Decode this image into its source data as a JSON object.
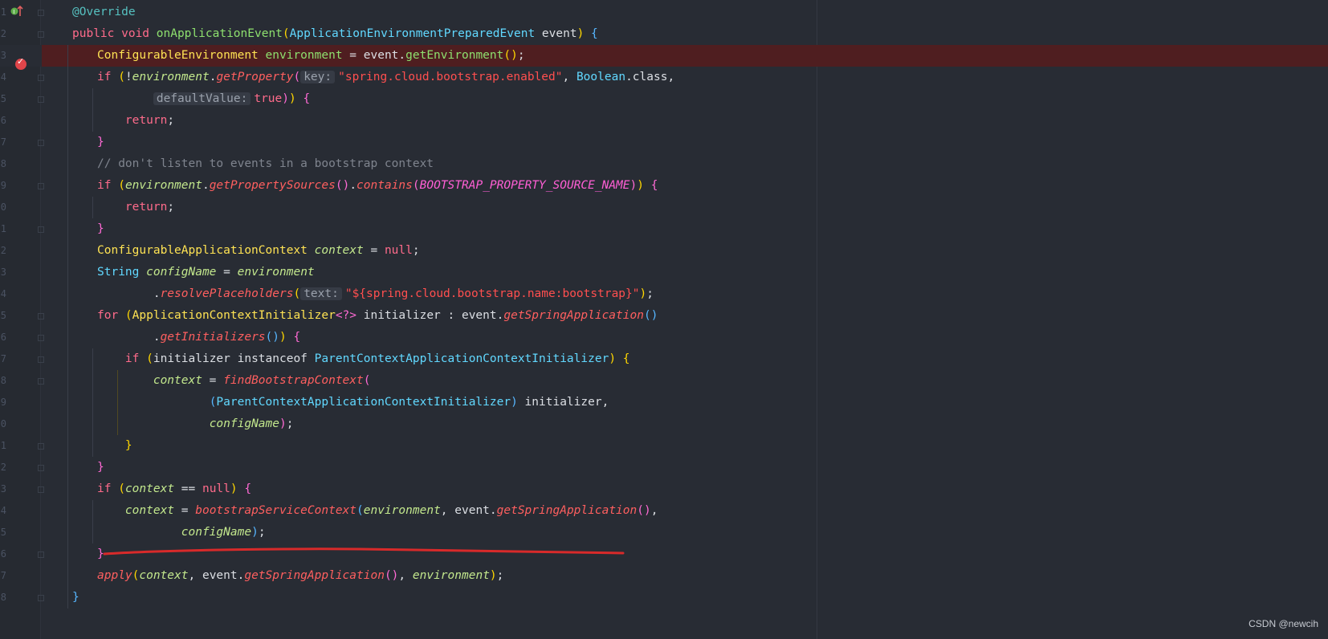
{
  "editor": {
    "watermark": "CSDN @newcih",
    "line_numbers": [
      "1",
      "2",
      "3",
      "4",
      "5",
      "6",
      "7",
      "8",
      "9",
      "0",
      "1",
      "2",
      "3",
      "4",
      "5",
      "6",
      "7",
      "8",
      "9",
      "0",
      "1",
      "2",
      "3",
      "4",
      "5",
      "6",
      "7",
      "8"
    ],
    "lines": [
      [
        [
          "ann",
          "@Override"
        ]
      ],
      [
        [
          "kw",
          "public void "
        ],
        [
          "fn",
          "onApplicationEvent"
        ],
        [
          "p1",
          "("
        ],
        [
          "type2",
          "ApplicationEnvironmentPreparedEvent "
        ],
        [
          "plain",
          "event"
        ],
        [
          "p1",
          ")"
        ],
        [
          "plain",
          " "
        ],
        [
          "p3",
          "{"
        ]
      ],
      [
        [
          "type",
          "ConfigurableEnvironment "
        ],
        [
          "fn",
          "environment"
        ],
        [
          "plain",
          " = "
        ],
        [
          "plain",
          "event."
        ],
        [
          "fn",
          "getEnvironment"
        ],
        [
          "p1",
          "()"
        ],
        [
          "plain",
          ";"
        ]
      ],
      [
        [
          "kw",
          "if "
        ],
        [
          "p1",
          "("
        ],
        [
          "plain",
          "!"
        ],
        [
          "v",
          "environment"
        ],
        [
          "plain",
          "."
        ],
        [
          "m",
          "getProperty"
        ],
        [
          "p2",
          "("
        ],
        [
          "hint",
          "key:"
        ],
        [
          "str",
          "\"spring.cloud.bootstrap.enabled\""
        ],
        [
          "plain",
          ", "
        ],
        [
          "type2",
          "Boolean"
        ],
        [
          "plain",
          "."
        ],
        [
          "plain",
          "class,"
        ]
      ],
      [
        [
          "plain",
          "        "
        ],
        [
          "hint",
          "defaultValue:"
        ],
        [
          "kw",
          "true"
        ],
        [
          "p2",
          ")"
        ],
        [
          "p1",
          ")"
        ],
        [
          "plain",
          " "
        ],
        [
          "p2",
          "{"
        ]
      ],
      [
        [
          "plain",
          "    "
        ],
        [
          "kw",
          "return"
        ],
        [
          "plain",
          ";"
        ]
      ],
      [
        [
          "p2",
          "}"
        ]
      ],
      [
        [
          "cmt",
          "// don't listen to events in a bootstrap context"
        ]
      ],
      [
        [
          "kw",
          "if "
        ],
        [
          "p1",
          "("
        ],
        [
          "v",
          "environment"
        ],
        [
          "plain",
          "."
        ],
        [
          "m",
          "getPropertySources"
        ],
        [
          "p2",
          "()"
        ],
        [
          "plain",
          "."
        ],
        [
          "m",
          "contains"
        ],
        [
          "p2",
          "("
        ],
        [
          "const",
          "BOOTSTRAP_PROPERTY_SOURCE_NAME"
        ],
        [
          "p2",
          ")"
        ],
        [
          "p1",
          ")"
        ],
        [
          "plain",
          " "
        ],
        [
          "p2",
          "{"
        ]
      ],
      [
        [
          "plain",
          "    "
        ],
        [
          "kw",
          "return"
        ],
        [
          "plain",
          ";"
        ]
      ],
      [
        [
          "p2",
          "}"
        ]
      ],
      [
        [
          "type",
          "ConfigurableApplicationContext "
        ],
        [
          "v",
          "context"
        ],
        [
          "plain",
          " = "
        ],
        [
          "kw",
          "null"
        ],
        [
          "plain",
          ";"
        ]
      ],
      [
        [
          "type2",
          "String "
        ],
        [
          "v",
          "configName"
        ],
        [
          "plain",
          " = "
        ],
        [
          "v",
          "environment"
        ]
      ],
      [
        [
          "plain",
          "        ."
        ],
        [
          "m",
          "resolvePlaceholders"
        ],
        [
          "p1",
          "("
        ],
        [
          "hint",
          "text:"
        ],
        [
          "str",
          "\"${spring.cloud.bootstrap.name:bootstrap}\""
        ],
        [
          "p1",
          ")"
        ],
        [
          "plain",
          ";"
        ]
      ],
      [
        [
          "kw",
          "for "
        ],
        [
          "p1",
          "("
        ],
        [
          "type",
          "ApplicationContextInitializer"
        ],
        [
          "p2",
          "<?>"
        ],
        [
          "plain",
          " initializer : event."
        ],
        [
          "m",
          "getSpringApplication"
        ],
        [
          "p3",
          "()"
        ]
      ],
      [
        [
          "plain",
          "        ."
        ],
        [
          "m",
          "getInitializers"
        ],
        [
          "p3",
          "()"
        ],
        [
          "p1",
          ")"
        ],
        [
          "plain",
          " "
        ],
        [
          "p2",
          "{"
        ]
      ],
      [
        [
          "plain",
          "    "
        ],
        [
          "kw",
          "if "
        ],
        [
          "p1",
          "("
        ],
        [
          "plain",
          "initializer instanceof "
        ],
        [
          "type2",
          "ParentContextApplicationContextInitializer"
        ],
        [
          "p1",
          ")"
        ],
        [
          "plain",
          " "
        ],
        [
          "p1",
          "{"
        ]
      ],
      [
        [
          "plain",
          "        "
        ],
        [
          "v",
          "context"
        ],
        [
          "plain",
          " = "
        ],
        [
          "m",
          "findBootstrapContext"
        ],
        [
          "p2",
          "("
        ]
      ],
      [
        [
          "plain",
          "                "
        ],
        [
          "p3",
          "("
        ],
        [
          "type2",
          "ParentContextApplicationContextInitializer"
        ],
        [
          "p3",
          ")"
        ],
        [
          "plain",
          " initializer,"
        ]
      ],
      [
        [
          "plain",
          "                "
        ],
        [
          "v",
          "configName"
        ],
        [
          "p2",
          ")"
        ],
        [
          "plain",
          ";"
        ]
      ],
      [
        [
          "plain",
          "    "
        ],
        [
          "p1",
          "}"
        ]
      ],
      [
        [
          "p2",
          "}"
        ]
      ],
      [
        [
          "kw",
          "if "
        ],
        [
          "p1",
          "("
        ],
        [
          "v",
          "context"
        ],
        [
          "plain",
          " == "
        ],
        [
          "kw",
          "null"
        ],
        [
          "p1",
          ")"
        ],
        [
          "plain",
          " "
        ],
        [
          "p2",
          "{"
        ]
      ],
      [
        [
          "plain",
          "    "
        ],
        [
          "v",
          "context"
        ],
        [
          "plain",
          " = "
        ],
        [
          "m",
          "bootstrapServiceContext"
        ],
        [
          "p3",
          "("
        ],
        [
          "v",
          "environment"
        ],
        [
          "plain",
          ", event."
        ],
        [
          "m",
          "getSpringApplication"
        ],
        [
          "p2",
          "()"
        ],
        [
          "plain",
          ","
        ]
      ],
      [
        [
          "plain",
          "            "
        ],
        [
          "v",
          "configName"
        ],
        [
          "p3",
          ")"
        ],
        [
          "plain",
          ";"
        ]
      ],
      [
        [
          "p2",
          "}"
        ]
      ],
      [
        [
          "m",
          "apply"
        ],
        [
          "p1",
          "("
        ],
        [
          "v",
          "context"
        ],
        [
          "plain",
          ", event."
        ],
        [
          "m",
          "getSpringApplication"
        ],
        [
          "p2",
          "()"
        ],
        [
          "plain",
          ", "
        ],
        [
          "v",
          "environment"
        ],
        [
          "p1",
          ")"
        ],
        [
          "plain",
          ";"
        ]
      ],
      [
        [
          "p3",
          "}"
        ]
      ]
    ],
    "indents": [
      0,
      0,
      1,
      1,
      1,
      1,
      1,
      1,
      1,
      1,
      1,
      1,
      1,
      1,
      1,
      1,
      1,
      1,
      1,
      1,
      1,
      1,
      1,
      1,
      1,
      1,
      1,
      0
    ],
    "breakpoint_line": 3
  }
}
